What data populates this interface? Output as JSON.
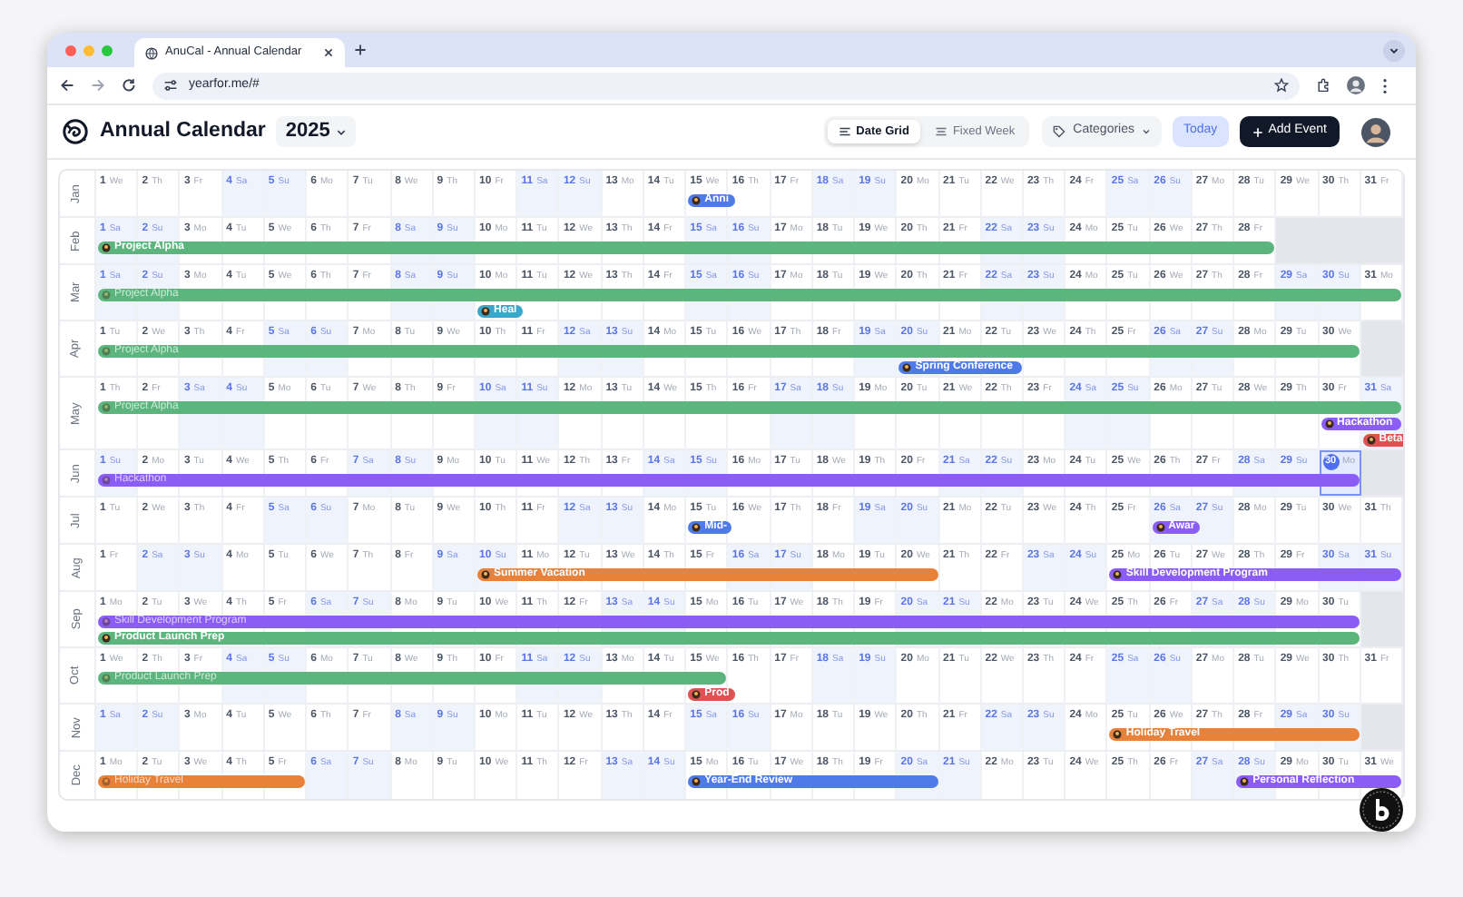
{
  "browser": {
    "tab_title": "AnuCal - Annual Calendar",
    "url": "yearfor.me/#"
  },
  "header": {
    "title": "Annual Calendar",
    "year": "2025",
    "views": [
      {
        "label": "Date Grid",
        "selected": true
      },
      {
        "label": "Fixed Week",
        "selected": false
      }
    ],
    "categories": "Categories",
    "today_button": "Today",
    "add_event_button": "Add Event"
  },
  "months": [
    {
      "label": "Jan",
      "days": [
        [
          "1",
          "We",
          false,
          false
        ],
        [
          "2",
          "Th",
          false,
          false
        ],
        [
          "3",
          "Fr",
          false,
          false
        ],
        [
          "4",
          "Sa",
          true,
          false
        ],
        [
          "5",
          "Su",
          true,
          false
        ],
        [
          "6",
          "Mo",
          false,
          false
        ],
        [
          "7",
          "Tu",
          false,
          false
        ],
        [
          "8",
          "We",
          false,
          false
        ],
        [
          "9",
          "Th",
          false,
          false
        ],
        [
          "10",
          "Fr",
          false,
          false
        ],
        [
          "11",
          "Sa",
          true,
          false
        ],
        [
          "12",
          "Su",
          true,
          false
        ],
        [
          "13",
          "Mo",
          false,
          false
        ],
        [
          "14",
          "Tu",
          false,
          false
        ],
        [
          "15",
          "We",
          false,
          false
        ],
        [
          "16",
          "Th",
          false,
          false
        ],
        [
          "17",
          "Fr",
          false,
          false
        ],
        [
          "18",
          "Sa",
          true,
          false
        ],
        [
          "19",
          "Su",
          true,
          false
        ],
        [
          "20",
          "Mo",
          false,
          false
        ],
        [
          "21",
          "Tu",
          false,
          false
        ],
        [
          "22",
          "We",
          false,
          false
        ],
        [
          "23",
          "Th",
          false,
          false
        ],
        [
          "24",
          "Fr",
          false,
          false
        ],
        [
          "25",
          "Sa",
          true,
          false
        ],
        [
          "26",
          "Su",
          true,
          false
        ],
        [
          "27",
          "Mo",
          false,
          false
        ],
        [
          "28",
          "Tu",
          false,
          false
        ],
        [
          "29",
          "We",
          false,
          false
        ],
        [
          "30",
          "Th",
          false,
          false
        ],
        [
          "31",
          "Fr",
          false,
          false
        ]
      ],
      "lanes": [
        [
          {
            "label": "Anni",
            "color": "#4f7be8",
            "continued": false
          }
        ]
      ]
    },
    {
      "label": "Feb",
      "days": [
        [
          "1",
          "Sa",
          true,
          false
        ],
        [
          "2",
          "Su",
          true,
          false
        ],
        [
          "3",
          "Mo",
          false,
          false
        ],
        [
          "4",
          "Tu",
          false,
          false
        ],
        [
          "5",
          "We",
          false,
          false
        ],
        [
          "6",
          "Th",
          false,
          false
        ],
        [
          "7",
          "Fr",
          false,
          false
        ],
        [
          "8",
          "Sa",
          true,
          false
        ],
        [
          "9",
          "Su",
          true,
          false
        ],
        [
          "10",
          "Mo",
          false,
          false
        ],
        [
          "11",
          "Tu",
          false,
          false
        ],
        [
          "12",
          "We",
          false,
          false
        ],
        [
          "13",
          "Th",
          false,
          false
        ],
        [
          "14",
          "Fr",
          false,
          false
        ],
        [
          "15",
          "Sa",
          true,
          false
        ],
        [
          "16",
          "Su",
          true,
          false
        ],
        [
          "17",
          "Mo",
          false,
          false
        ],
        [
          "18",
          "Tu",
          false,
          false
        ],
        [
          "19",
          "We",
          false,
          false
        ],
        [
          "20",
          "Th",
          false,
          false
        ],
        [
          "21",
          "Fr",
          false,
          false
        ],
        [
          "22",
          "Sa",
          true,
          false
        ],
        [
          "23",
          "Su",
          true,
          false
        ],
        [
          "24",
          "Mo",
          false,
          false
        ],
        [
          "25",
          "Tu",
          false,
          false
        ],
        [
          "26",
          "We",
          false,
          false
        ],
        [
          "27",
          "Th",
          false,
          false
        ],
        [
          "28",
          "Fr",
          false,
          false
        ]
      ],
      "lanes": [
        [
          {
            "label": "Project Alpha",
            "color": "#5bb57d",
            "continued": false
          }
        ]
      ]
    },
    {
      "label": "Mar",
      "days": [
        [
          "1",
          "Sa",
          true,
          false
        ],
        [
          "2",
          "Su",
          true,
          false
        ],
        [
          "3",
          "Mo",
          false,
          false
        ],
        [
          "4",
          "Tu",
          false,
          false
        ],
        [
          "5",
          "We",
          false,
          false
        ],
        [
          "6",
          "Th",
          false,
          false
        ],
        [
          "7",
          "Fr",
          false,
          false
        ],
        [
          "8",
          "Sa",
          true,
          false
        ],
        [
          "9",
          "Su",
          true,
          false
        ],
        [
          "10",
          "Mo",
          false,
          false
        ],
        [
          "11",
          "Tu",
          false,
          false
        ],
        [
          "12",
          "We",
          false,
          false
        ],
        [
          "13",
          "Th",
          false,
          false
        ],
        [
          "14",
          "Fr",
          false,
          false
        ],
        [
          "15",
          "Sa",
          true,
          false
        ],
        [
          "16",
          "Su",
          true,
          false
        ],
        [
          "17",
          "Mo",
          false,
          false
        ],
        [
          "18",
          "Tu",
          false,
          false
        ],
        [
          "19",
          "We",
          false,
          false
        ],
        [
          "20",
          "Th",
          false,
          false
        ],
        [
          "21",
          "Fr",
          false,
          false
        ],
        [
          "22",
          "Sa",
          true,
          false
        ],
        [
          "23",
          "Su",
          true,
          false
        ],
        [
          "24",
          "Mo",
          false,
          false
        ],
        [
          "25",
          "Tu",
          false,
          false
        ],
        [
          "26",
          "We",
          false,
          false
        ],
        [
          "27",
          "Th",
          false,
          false
        ],
        [
          "28",
          "Fr",
          false,
          false
        ],
        [
          "29",
          "Sa",
          true,
          false
        ],
        [
          "30",
          "Su",
          true,
          false
        ],
        [
          "31",
          "Mo",
          false,
          false
        ]
      ],
      "lanes": [
        [
          {
            "label": "Project Alpha",
            "color": "#5bb57d",
            "continued": true
          }
        ],
        [
          {
            "label": "Heal",
            "color": "#3aa6c9",
            "continued": false
          }
        ]
      ]
    },
    {
      "label": "Apr",
      "days": [
        [
          "1",
          "Tu",
          false,
          false
        ],
        [
          "2",
          "We",
          false,
          false
        ],
        [
          "3",
          "Th",
          false,
          false
        ],
        [
          "4",
          "Fr",
          false,
          false
        ],
        [
          "5",
          "Sa",
          true,
          false
        ],
        [
          "6",
          "Su",
          true,
          false
        ],
        [
          "7",
          "Mo",
          false,
          false
        ],
        [
          "8",
          "Tu",
          false,
          false
        ],
        [
          "9",
          "We",
          false,
          false
        ],
        [
          "10",
          "Th",
          false,
          false
        ],
        [
          "11",
          "Fr",
          false,
          false
        ],
        [
          "12",
          "Sa",
          true,
          false
        ],
        [
          "13",
          "Su",
          true,
          false
        ],
        [
          "14",
          "Mo",
          false,
          false
        ],
        [
          "15",
          "Tu",
          false,
          false
        ],
        [
          "16",
          "We",
          false,
          false
        ],
        [
          "17",
          "Th",
          false,
          false
        ],
        [
          "18",
          "Fr",
          false,
          false
        ],
        [
          "19",
          "Sa",
          true,
          false
        ],
        [
          "20",
          "Su",
          true,
          false
        ],
        [
          "21",
          "Mo",
          false,
          false
        ],
        [
          "22",
          "Tu",
          false,
          false
        ],
        [
          "23",
          "We",
          false,
          false
        ],
        [
          "24",
          "Th",
          false,
          false
        ],
        [
          "25",
          "Fr",
          false,
          false
        ],
        [
          "26",
          "Sa",
          true,
          false
        ],
        [
          "27",
          "Su",
          true,
          false
        ],
        [
          "28",
          "Mo",
          false,
          false
        ],
        [
          "29",
          "Tu",
          false,
          false
        ],
        [
          "30",
          "We",
          false,
          false
        ]
      ],
      "lanes": [
        [
          {
            "label": "Project Alpha",
            "color": "#5bb57d",
            "continued": true
          }
        ],
        [
          {
            "label": "Spring Conference",
            "color": "#4f7be8",
            "continued": false
          }
        ]
      ]
    },
    {
      "label": "May",
      "days": [
        [
          "1",
          "Th",
          false,
          false
        ],
        [
          "2",
          "Fr",
          false,
          false
        ],
        [
          "3",
          "Sa",
          true,
          false
        ],
        [
          "4",
          "Su",
          true,
          false
        ],
        [
          "5",
          "Mo",
          false,
          false
        ],
        [
          "6",
          "Tu",
          false,
          false
        ],
        [
          "7",
          "We",
          false,
          false
        ],
        [
          "8",
          "Th",
          false,
          false
        ],
        [
          "9",
          "Fr",
          false,
          false
        ],
        [
          "10",
          "Sa",
          true,
          false
        ],
        [
          "11",
          "Su",
          true,
          false
        ],
        [
          "12",
          "Mo",
          false,
          false
        ],
        [
          "13",
          "Tu",
          false,
          false
        ],
        [
          "14",
          "We",
          false,
          false
        ],
        [
          "15",
          "Th",
          false,
          false
        ],
        [
          "16",
          "Fr",
          false,
          false
        ],
        [
          "17",
          "Sa",
          true,
          false
        ],
        [
          "18",
          "Su",
          true,
          false
        ],
        [
          "19",
          "Mo",
          false,
          false
        ],
        [
          "20",
          "Tu",
          false,
          false
        ],
        [
          "21",
          "We",
          false,
          false
        ],
        [
          "22",
          "Th",
          false,
          false
        ],
        [
          "23",
          "Fr",
          false,
          false
        ],
        [
          "24",
          "Sa",
          true,
          false
        ],
        [
          "25",
          "Su",
          true,
          false
        ],
        [
          "26",
          "Mo",
          false,
          false
        ],
        [
          "27",
          "Tu",
          false,
          false
        ],
        [
          "28",
          "We",
          false,
          false
        ],
        [
          "29",
          "Th",
          false,
          false
        ],
        [
          "30",
          "Fr",
          false,
          false
        ],
        [
          "31",
          "Sa",
          true,
          false
        ]
      ],
      "lanes": [
        [
          {
            "label": "Project Alpha",
            "color": "#5bb57d",
            "continued": true
          }
        ],
        [
          {
            "label": "Hackathon",
            "color": "#8b5cf6",
            "continued": false
          }
        ],
        [
          {
            "label": "Beta",
            "color": "#e05252",
            "continued": false
          }
        ]
      ]
    },
    {
      "label": "Jun",
      "days": [
        [
          "1",
          "Su",
          true,
          false
        ],
        [
          "2",
          "Mo",
          false,
          false
        ],
        [
          "3",
          "Tu",
          false,
          false
        ],
        [
          "4",
          "We",
          false,
          false
        ],
        [
          "5",
          "Th",
          false,
          false
        ],
        [
          "6",
          "Fr",
          false,
          false
        ],
        [
          "7",
          "Sa",
          true,
          false
        ],
        [
          "8",
          "Su",
          true,
          false
        ],
        [
          "9",
          "Mo",
          false,
          false
        ],
        [
          "10",
          "Tu",
          false,
          false
        ],
        [
          "11",
          "We",
          false,
          false
        ],
        [
          "12",
          "Th",
          false,
          false
        ],
        [
          "13",
          "Fr",
          false,
          false
        ],
        [
          "14",
          "Sa",
          true,
          false
        ],
        [
          "15",
          "Su",
          true,
          false
        ],
        [
          "16",
          "Mo",
          false,
          false
        ],
        [
          "17",
          "Tu",
          false,
          false
        ],
        [
          "18",
          "We",
          false,
          false
        ],
        [
          "19",
          "Th",
          false,
          false
        ],
        [
          "20",
          "Fr",
          false,
          false
        ],
        [
          "21",
          "Sa",
          true,
          false
        ],
        [
          "22",
          "Su",
          true,
          false
        ],
        [
          "23",
          "Mo",
          false,
          false
        ],
        [
          "24",
          "Tu",
          false,
          false
        ],
        [
          "25",
          "We",
          false,
          false
        ],
        [
          "26",
          "Th",
          false,
          false
        ],
        [
          "27",
          "Fr",
          false,
          false
        ],
        [
          "28",
          "Sa",
          true,
          false
        ],
        [
          "29",
          "Su",
          true,
          false
        ],
        [
          "30",
          "Mo",
          false,
          true
        ]
      ],
      "lanes": [
        [
          {
            "label": "Hackathon",
            "color": "#8b5cf6",
            "continued": true
          }
        ]
      ]
    },
    {
      "label": "Jul",
      "days": [
        [
          "1",
          "Tu",
          false,
          false
        ],
        [
          "2",
          "We",
          false,
          false
        ],
        [
          "3",
          "Th",
          false,
          false
        ],
        [
          "4",
          "Fr",
          false,
          false
        ],
        [
          "5",
          "Sa",
          true,
          false
        ],
        [
          "6",
          "Su",
          true,
          false
        ],
        [
          "7",
          "Mo",
          false,
          false
        ],
        [
          "8",
          "Tu",
          false,
          false
        ],
        [
          "9",
          "We",
          false,
          false
        ],
        [
          "10",
          "Th",
          false,
          false
        ],
        [
          "11",
          "Fr",
          false,
          false
        ],
        [
          "12",
          "Sa",
          true,
          false
        ],
        [
          "13",
          "Su",
          true,
          false
        ],
        [
          "14",
          "Mo",
          false,
          false
        ],
        [
          "15",
          "Tu",
          false,
          false
        ],
        [
          "16",
          "We",
          false,
          false
        ],
        [
          "17",
          "Th",
          false,
          false
        ],
        [
          "18",
          "Fr",
          false,
          false
        ],
        [
          "19",
          "Sa",
          true,
          false
        ],
        [
          "20",
          "Su",
          true,
          false
        ],
        [
          "21",
          "Mo",
          false,
          false
        ],
        [
          "22",
          "Tu",
          false,
          false
        ],
        [
          "23",
          "We",
          false,
          false
        ],
        [
          "24",
          "Th",
          false,
          false
        ],
        [
          "25",
          "Fr",
          false,
          false
        ],
        [
          "26",
          "Sa",
          true,
          false
        ],
        [
          "27",
          "Su",
          true,
          false
        ],
        [
          "28",
          "Mo",
          false,
          false
        ],
        [
          "29",
          "Tu",
          false,
          false
        ],
        [
          "30",
          "We",
          false,
          false
        ],
        [
          "31",
          "Th",
          false,
          false
        ]
      ],
      "lanes": [
        [
          {
            "label": "Mid-",
            "color": "#4f7be8",
            "continued": false
          },
          {
            "label": "Awar",
            "color": "#8b5cf6",
            "continued": false
          }
        ]
      ]
    },
    {
      "label": "Aug",
      "days": [
        [
          "1",
          "Fr",
          false,
          false
        ],
        [
          "2",
          "Sa",
          true,
          false
        ],
        [
          "3",
          "Su",
          true,
          false
        ],
        [
          "4",
          "Mo",
          false,
          false
        ],
        [
          "5",
          "Tu",
          false,
          false
        ],
        [
          "6",
          "We",
          false,
          false
        ],
        [
          "7",
          "Th",
          false,
          false
        ],
        [
          "8",
          "Fr",
          false,
          false
        ],
        [
          "9",
          "Sa",
          true,
          false
        ],
        [
          "10",
          "Su",
          true,
          false
        ],
        [
          "11",
          "Mo",
          false,
          false
        ],
        [
          "12",
          "Tu",
          false,
          false
        ],
        [
          "13",
          "We",
          false,
          false
        ],
        [
          "14",
          "Th",
          false,
          false
        ],
        [
          "15",
          "Fr",
          false,
          false
        ],
        [
          "16",
          "Sa",
          true,
          false
        ],
        [
          "17",
          "Su",
          true,
          false
        ],
        [
          "18",
          "Mo",
          false,
          false
        ],
        [
          "19",
          "Tu",
          false,
          false
        ],
        [
          "20",
          "We",
          false,
          false
        ],
        [
          "21",
          "Th",
          false,
          false
        ],
        [
          "22",
          "Fr",
          false,
          false
        ],
        [
          "23",
          "Sa",
          true,
          false
        ],
        [
          "24",
          "Su",
          true,
          false
        ],
        [
          "25",
          "Mo",
          false,
          false
        ],
        [
          "26",
          "Tu",
          false,
          false
        ],
        [
          "27",
          "We",
          false,
          false
        ],
        [
          "28",
          "Th",
          false,
          false
        ],
        [
          "29",
          "Fr",
          false,
          false
        ],
        [
          "30",
          "Sa",
          true,
          false
        ],
        [
          "31",
          "Su",
          true,
          false
        ]
      ],
      "lanes": [
        [
          {
            "label": "Summer Vacation",
            "color": "#e8823a",
            "continued": false
          },
          {
            "label": "Skill Development Program",
            "color": "#8b5cf6",
            "continued": false
          }
        ]
      ]
    },
    {
      "label": "Sep",
      "days": [
        [
          "1",
          "Mo",
          false,
          false
        ],
        [
          "2",
          "Tu",
          false,
          false
        ],
        [
          "3",
          "We",
          false,
          false
        ],
        [
          "4",
          "Th",
          false,
          false
        ],
        [
          "5",
          "Fr",
          false,
          false
        ],
        [
          "6",
          "Sa",
          true,
          false
        ],
        [
          "7",
          "Su",
          true,
          false
        ],
        [
          "8",
          "Mo",
          false,
          false
        ],
        [
          "9",
          "Tu",
          false,
          false
        ],
        [
          "10",
          "We",
          false,
          false
        ],
        [
          "11",
          "Th",
          false,
          false
        ],
        [
          "12",
          "Fr",
          false,
          false
        ],
        [
          "13",
          "Sa",
          true,
          false
        ],
        [
          "14",
          "Su",
          true,
          false
        ],
        [
          "15",
          "Mo",
          false,
          false
        ],
        [
          "16",
          "Tu",
          false,
          false
        ],
        [
          "17",
          "We",
          false,
          false
        ],
        [
          "18",
          "Th",
          false,
          false
        ],
        [
          "19",
          "Fr",
          false,
          false
        ],
        [
          "20",
          "Sa",
          true,
          false
        ],
        [
          "21",
          "Su",
          true,
          false
        ],
        [
          "22",
          "Mo",
          false,
          false
        ],
        [
          "23",
          "Tu",
          false,
          false
        ],
        [
          "24",
          "We",
          false,
          false
        ],
        [
          "25",
          "Th",
          false,
          false
        ],
        [
          "26",
          "Fr",
          false,
          false
        ],
        [
          "27",
          "Sa",
          true,
          false
        ],
        [
          "28",
          "Su",
          true,
          false
        ],
        [
          "29",
          "Mo",
          false,
          false
        ],
        [
          "30",
          "Tu",
          false,
          false
        ]
      ],
      "lanes": [
        [
          {
            "label": "Skill Development Program",
            "color": "#8b5cf6",
            "continued": true
          }
        ],
        [
          {
            "label": "Product Launch Prep",
            "color": "#5bb57d",
            "continued": false
          }
        ]
      ]
    },
    {
      "label": "Oct",
      "days": [
        [
          "1",
          "We",
          false,
          false
        ],
        [
          "2",
          "Th",
          false,
          false
        ],
        [
          "3",
          "Fr",
          false,
          false
        ],
        [
          "4",
          "Sa",
          true,
          false
        ],
        [
          "5",
          "Su",
          true,
          false
        ],
        [
          "6",
          "Mo",
          false,
          false
        ],
        [
          "7",
          "Tu",
          false,
          false
        ],
        [
          "8",
          "We",
          false,
          false
        ],
        [
          "9",
          "Th",
          false,
          false
        ],
        [
          "10",
          "Fr",
          false,
          false
        ],
        [
          "11",
          "Sa",
          true,
          false
        ],
        [
          "12",
          "Su",
          true,
          false
        ],
        [
          "13",
          "Mo",
          false,
          false
        ],
        [
          "14",
          "Tu",
          false,
          false
        ],
        [
          "15",
          "We",
          false,
          false
        ],
        [
          "16",
          "Th",
          false,
          false
        ],
        [
          "17",
          "Fr",
          false,
          false
        ],
        [
          "18",
          "Sa",
          true,
          false
        ],
        [
          "19",
          "Su",
          true,
          false
        ],
        [
          "20",
          "Mo",
          false,
          false
        ],
        [
          "21",
          "Tu",
          false,
          false
        ],
        [
          "22",
          "We",
          false,
          false
        ],
        [
          "23",
          "Th",
          false,
          false
        ],
        [
          "24",
          "Fr",
          false,
          false
        ],
        [
          "25",
          "Sa",
          true,
          false
        ],
        [
          "26",
          "Su",
          true,
          false
        ],
        [
          "27",
          "Mo",
          false,
          false
        ],
        [
          "28",
          "Tu",
          false,
          false
        ],
        [
          "29",
          "We",
          false,
          false
        ],
        [
          "30",
          "Th",
          false,
          false
        ],
        [
          "31",
          "Fr",
          false,
          false
        ]
      ],
      "lanes": [
        [
          {
            "label": "Product Launch Prep",
            "color": "#5bb57d",
            "continued": true
          }
        ],
        [
          {
            "label": "Prod",
            "color": "#e05252",
            "continued": false
          }
        ]
      ]
    },
    {
      "label": "Nov",
      "days": [
        [
          "1",
          "Sa",
          true,
          false
        ],
        [
          "2",
          "Su",
          true,
          false
        ],
        [
          "3",
          "Mo",
          false,
          false
        ],
        [
          "4",
          "Tu",
          false,
          false
        ],
        [
          "5",
          "We",
          false,
          false
        ],
        [
          "6",
          "Th",
          false,
          false
        ],
        [
          "7",
          "Fr",
          false,
          false
        ],
        [
          "8",
          "Sa",
          true,
          false
        ],
        [
          "9",
          "Su",
          true,
          false
        ],
        [
          "10",
          "Mo",
          false,
          false
        ],
        [
          "11",
          "Tu",
          false,
          false
        ],
        [
          "12",
          "We",
          false,
          false
        ],
        [
          "13",
          "Th",
          false,
          false
        ],
        [
          "14",
          "Fr",
          false,
          false
        ],
        [
          "15",
          "Sa",
          true,
          false
        ],
        [
          "16",
          "Su",
          true,
          false
        ],
        [
          "17",
          "Mo",
          false,
          false
        ],
        [
          "18",
          "Tu",
          false,
          false
        ],
        [
          "19",
          "We",
          false,
          false
        ],
        [
          "20",
          "Th",
          false,
          false
        ],
        [
          "21",
          "Fr",
          false,
          false
        ],
        [
          "22",
          "Sa",
          true,
          false
        ],
        [
          "23",
          "Su",
          true,
          false
        ],
        [
          "24",
          "Mo",
          false,
          false
        ],
        [
          "25",
          "Tu",
          false,
          false
        ],
        [
          "26",
          "We",
          false,
          false
        ],
        [
          "27",
          "Th",
          false,
          false
        ],
        [
          "28",
          "Fr",
          false,
          false
        ],
        [
          "29",
          "Sa",
          true,
          false
        ],
        [
          "30",
          "Su",
          true,
          false
        ]
      ],
      "lanes": [
        [
          {
            "label": "Holiday Travel",
            "color": "#e8823a",
            "continued": false
          }
        ]
      ]
    },
    {
      "label": "Dec",
      "days": [
        [
          "1",
          "Mo",
          false,
          false
        ],
        [
          "2",
          "Tu",
          false,
          false
        ],
        [
          "3",
          "We",
          false,
          false
        ],
        [
          "4",
          "Th",
          false,
          false
        ],
        [
          "5",
          "Fr",
          false,
          false
        ],
        [
          "6",
          "Sa",
          true,
          false
        ],
        [
          "7",
          "Su",
          true,
          false
        ],
        [
          "8",
          "Mo",
          false,
          false
        ],
        [
          "9",
          "Tu",
          false,
          false
        ],
        [
          "10",
          "We",
          false,
          false
        ],
        [
          "11",
          "Th",
          false,
          false
        ],
        [
          "12",
          "Fr",
          false,
          false
        ],
        [
          "13",
          "Sa",
          true,
          false
        ],
        [
          "14",
          "Su",
          true,
          false
        ],
        [
          "15",
          "Mo",
          false,
          false
        ],
        [
          "16",
          "Tu",
          false,
          false
        ],
        [
          "17",
          "We",
          false,
          false
        ],
        [
          "18",
          "Th",
          false,
          false
        ],
        [
          "19",
          "Fr",
          false,
          false
        ],
        [
          "20",
          "Sa",
          true,
          false
        ],
        [
          "21",
          "Su",
          true,
          false
        ],
        [
          "22",
          "Mo",
          false,
          false
        ],
        [
          "23",
          "Tu",
          false,
          false
        ],
        [
          "24",
          "We",
          false,
          false
        ],
        [
          "25",
          "Th",
          false,
          false
        ],
        [
          "26",
          "Fr",
          false,
          false
        ],
        [
          "27",
          "Sa",
          true,
          false
        ],
        [
          "28",
          "Su",
          true,
          false
        ],
        [
          "29",
          "Mo",
          false,
          false
        ],
        [
          "30",
          "Tu",
          false,
          false
        ],
        [
          "31",
          "We",
          false,
          false
        ]
      ],
      "lanes": [
        [
          {
            "label": "Holiday Travel",
            "color": "#e8823a",
            "continued": true
          },
          {
            "label": "Year-End Review",
            "color": "#4f7be8",
            "continued": false
          },
          {
            "label": "Personal Reflection",
            "color": "#8b5cf6",
            "continued": false
          }
        ]
      ]
    }
  ]
}
